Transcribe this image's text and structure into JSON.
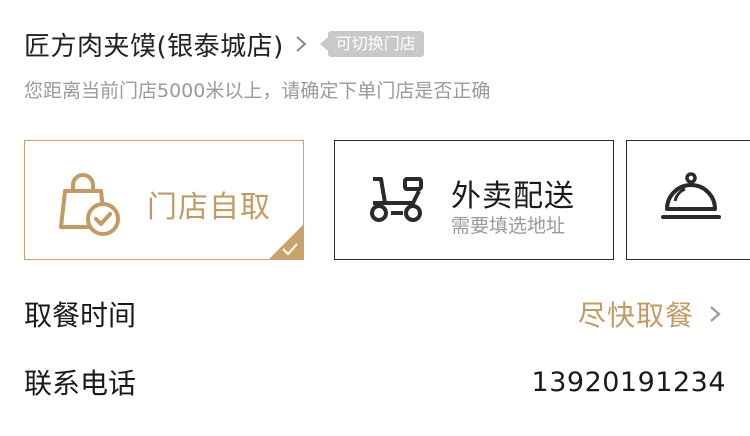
{
  "header": {
    "store_name": "匠方肉夹馍(银泰城店)",
    "switch_label": "可切换门店",
    "notice": "您距离当前门店5000米以上，请确定下单门店是否正确"
  },
  "order_types": [
    {
      "label": "门店自取",
      "icon": "shopping-bag-check-icon",
      "selected": true
    },
    {
      "label": "外卖配送",
      "sublabel": "需要填选地址",
      "icon": "scooter-icon",
      "selected": false
    },
    {
      "label": "",
      "icon": "food-cloche-icon",
      "selected": false
    }
  ],
  "pickup_time": {
    "label": "取餐时间",
    "value": "尽快取餐"
  },
  "contact": {
    "label": "联系电话",
    "value": "13920191234"
  },
  "colors": {
    "accent": "#c39b62",
    "text": "#1a1a1a",
    "muted": "#9a9a9a",
    "tag_bg": "#c9c9c9"
  }
}
